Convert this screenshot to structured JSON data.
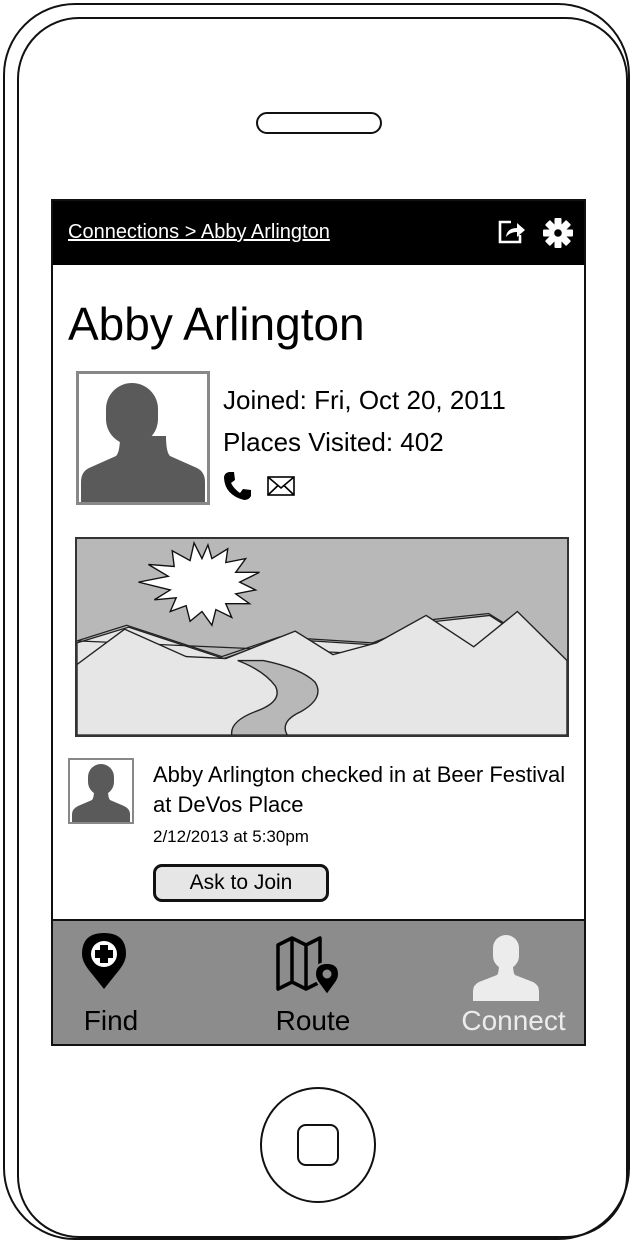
{
  "header": {
    "breadcrumb": "Connections > Abby Arlington",
    "share_icon": "share-icon",
    "settings_icon": "gear-icon"
  },
  "profile": {
    "name": "Abby Arlington",
    "joined": "Joined: Fri, Oct 20, 2011",
    "places_visited": "Places Visited: 402",
    "contact_icons": [
      "phone-icon",
      "mail-icon"
    ]
  },
  "activity": {
    "text": "Abby Arlington checked in at Beer Festival at DeVos Place",
    "timestamp": "2/12/2013 at 5:30pm",
    "action_label": "Ask to Join"
  },
  "tabs": [
    {
      "label": "Find",
      "icon": "map-pin-plus-icon",
      "active": false
    },
    {
      "label": "Route",
      "icon": "route-map-icon",
      "active": false
    },
    {
      "label": "Connect",
      "icon": "person-icon",
      "active": true
    }
  ],
  "colors": {
    "topbar": "#000000",
    "tabbar": "#8c8c8c",
    "active_tab": "#ececec",
    "placeholder": "#5a5a5a"
  }
}
